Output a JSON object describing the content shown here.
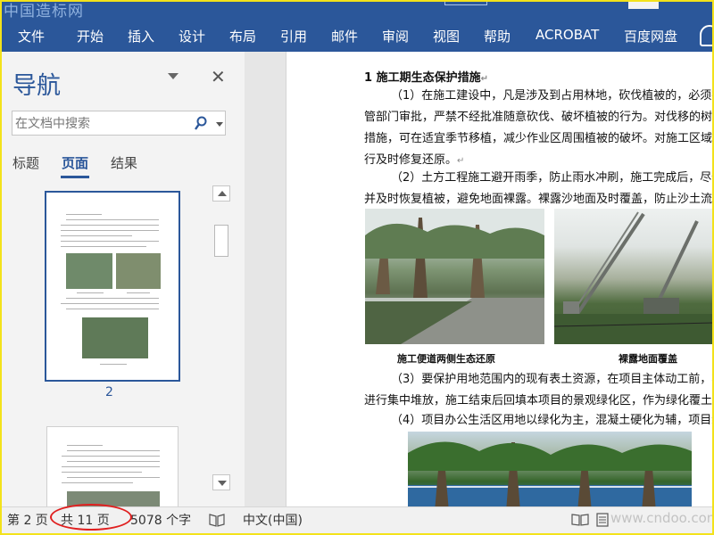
{
  "watermark": "中国造标网",
  "ribbon": {
    "tabs": [
      "文件",
      "开始",
      "插入",
      "设计",
      "布局",
      "引用",
      "邮件",
      "审阅",
      "视图",
      "帮助",
      "ACROBAT",
      "百度网盘"
    ]
  },
  "nav": {
    "title": "导航",
    "search_placeholder": "在文档中搜索",
    "tabs": [
      "标题",
      "页面",
      "结果"
    ],
    "current_page_label": "2"
  },
  "document": {
    "heading": "1 施工期生态保护措施",
    "lines": [
      "（1）在施工建设中，凡是涉及到占用林地，砍伐植被的，必须报请林",
      "管部门审批，严禁不经批准随意砍伐、破坏植被的行为。对伐移的树木采取",
      "措施，可在适宜季节移植，减少作业区周围植被的破坏。对施工区域生态环",
      "行及时修复还原。",
      "（2）土方工程施工避开雨季，防止雨水冲刷，施工完成后，尽快清理场",
      "并及时恢复植被，避免地面裸露。裸露沙地面及时覆盖，防止沙土流失。",
      "（3）要保护用地范围内的现有表土资源，在项目主体动工前，将剥离",
      "进行集中堆放，施工结束后回填本项目的景观绿化区，作为绿化覆土。",
      "（4）项目办公生活区用地以绿化为主，混凝土硬化为辅，项目绿化率达"
    ],
    "captions": [
      "施工便道两侧生态还原",
      "裸露地面覆盖"
    ]
  },
  "status": {
    "page": "第 2 页",
    "total": "共 11 页",
    "words": "5078 个字",
    "language": "中文(中国)"
  },
  "site_watermark": "www.cndoo.com"
}
